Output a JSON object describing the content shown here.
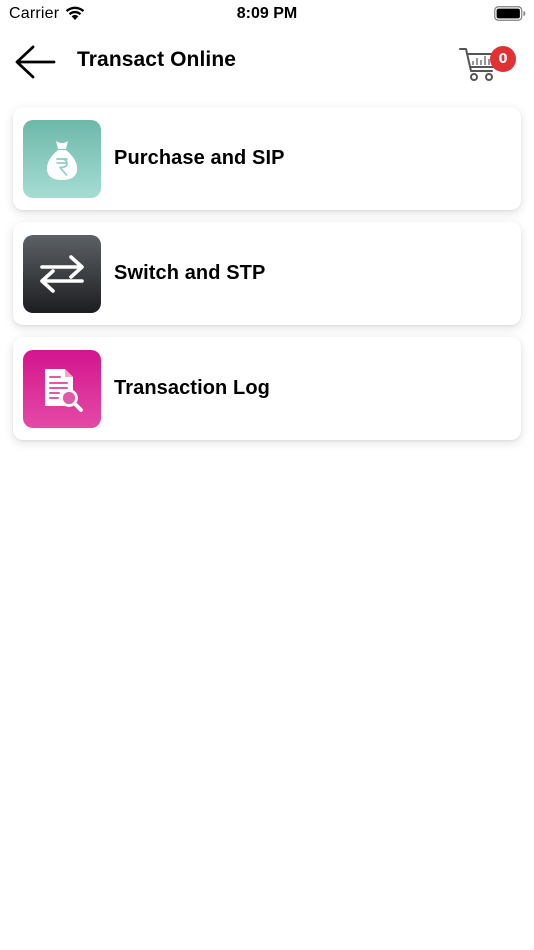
{
  "status_bar": {
    "carrier": "Carrier",
    "time": "8:09 PM"
  },
  "header": {
    "title": "Transact Online",
    "back_icon": "back-arrow-icon",
    "cart_icon": "shopping-cart-icon",
    "cart_count": "0",
    "badge_color": "#e03232"
  },
  "menu": {
    "items": [
      {
        "label": "Purchase and SIP",
        "icon": "money-bag-rupee-icon",
        "color": "#6db8aa"
      },
      {
        "label": "Switch and STP",
        "icon": "swap-arrows-icon",
        "color": "#3a3d41"
      },
      {
        "label": "Transaction Log",
        "icon": "document-search-icon",
        "color": "#d4148e"
      }
    ]
  }
}
